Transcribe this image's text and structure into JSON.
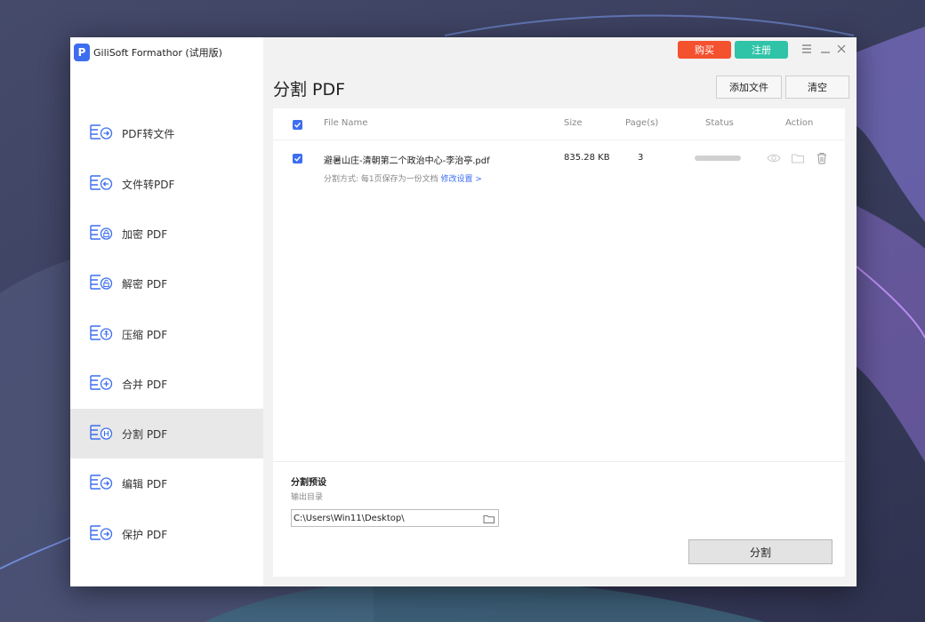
{
  "app": {
    "title": "GiliSoft Formathor (试用版)",
    "logo_letter": "P"
  },
  "topbar": {
    "buy_label": "购买",
    "register_label": "注册",
    "buy_color": "#f4512f",
    "register_color": "#2fc3a8"
  },
  "sidebar": {
    "items": [
      {
        "label": "PDF转文件"
      },
      {
        "label": "文件转PDF"
      },
      {
        "label": "加密 PDF"
      },
      {
        "label": "解密 PDF"
      },
      {
        "label": "压缩 PDF"
      },
      {
        "label": "合并 PDF"
      },
      {
        "label": "分割 PDF",
        "active": true
      },
      {
        "label": "编辑 PDF"
      },
      {
        "label": "保护 PDF"
      }
    ]
  },
  "main": {
    "page_title": "分割 PDF",
    "add_file_label": "添加文件",
    "clear_label": "清空",
    "table": {
      "headers": {
        "file_name": "File Name",
        "size": "Size",
        "pages": "Page(s)",
        "status": "Status",
        "action": "Action"
      },
      "rows": [
        {
          "file_name": "避暑山庄-清朝第二个政治中心-李治亭.pdf",
          "size": "835.28 KB",
          "pages": "3",
          "split_mode": "分割方式: 每1页保存为一份文档",
          "modify_link": "修改设置 >",
          "checked": true
        }
      ]
    },
    "preset": {
      "title": "分割预设",
      "output_label": "输出目录",
      "output_path": "C:\\Users\\Win11\\Desktop\\",
      "split_button": "分割"
    }
  },
  "colors": {
    "accent": "#3d6ef0"
  }
}
